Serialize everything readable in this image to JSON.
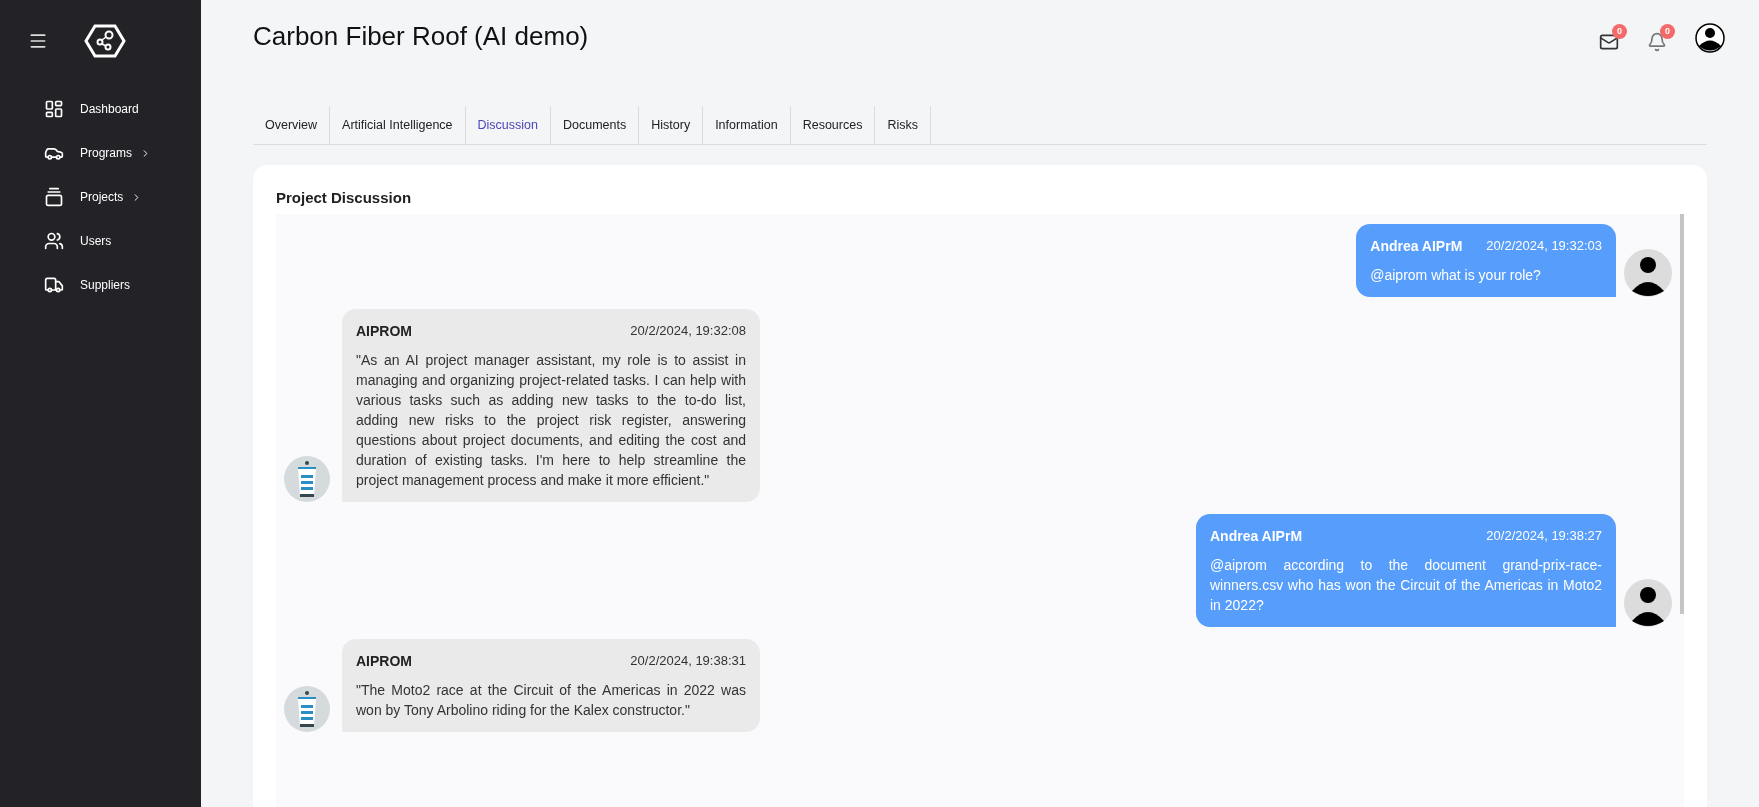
{
  "sidebar": {
    "items": [
      {
        "label": "Dashboard",
        "has_submenu": false
      },
      {
        "label": "Programs",
        "has_submenu": true
      },
      {
        "label": "Projects",
        "has_submenu": true
      },
      {
        "label": "Users",
        "has_submenu": false
      },
      {
        "label": "Suppliers",
        "has_submenu": false
      }
    ]
  },
  "header": {
    "title": "Carbon Fiber Roof (AI demo)",
    "mail_count": "0",
    "notification_count": "0"
  },
  "tabs": [
    {
      "label": "Overview",
      "selected": false
    },
    {
      "label": "Artificial Intelligence",
      "selected": false
    },
    {
      "label": "Discussion",
      "selected": true
    },
    {
      "label": "Documents",
      "selected": false
    },
    {
      "label": "History",
      "selected": false
    },
    {
      "label": "Information",
      "selected": false
    },
    {
      "label": "Resources",
      "selected": false
    },
    {
      "label": "Risks",
      "selected": false
    }
  ],
  "discussion": {
    "title": "Project Discussion",
    "messages": [
      {
        "kind": "user",
        "author": "Andrea AIPrM",
        "time": "20/2/2024, 19:32:03",
        "text": "@aiprom what is your role?"
      },
      {
        "kind": "assistant",
        "author": "AIPROM",
        "time": "20/2/2024, 19:32:08",
        "text": "\"As an AI project manager assistant, my role is to assist in managing and organizing project-related tasks. I can help with various tasks such as adding new tasks to the to-do list, adding new risks to the project risk register, answering questions about project documents, and editing the cost and duration of existing tasks. I'm here to help streamline the project management process and make it more efficient.\""
      },
      {
        "kind": "user",
        "author": "Andrea AIPrM",
        "time": "20/2/2024, 19:38:27",
        "text": "@aiprom according to the document grand-prix-race-winners.csv who has won the Circuit of the Americas in Moto2 in 2022?"
      },
      {
        "kind": "assistant",
        "author": "AIPROM",
        "time": "20/2/2024, 19:38:31",
        "text": "\"The Moto2 race at the Circuit of the Americas in 2022 was won by Tony Arbolino riding for the Kalex constructor.\""
      }
    ]
  }
}
